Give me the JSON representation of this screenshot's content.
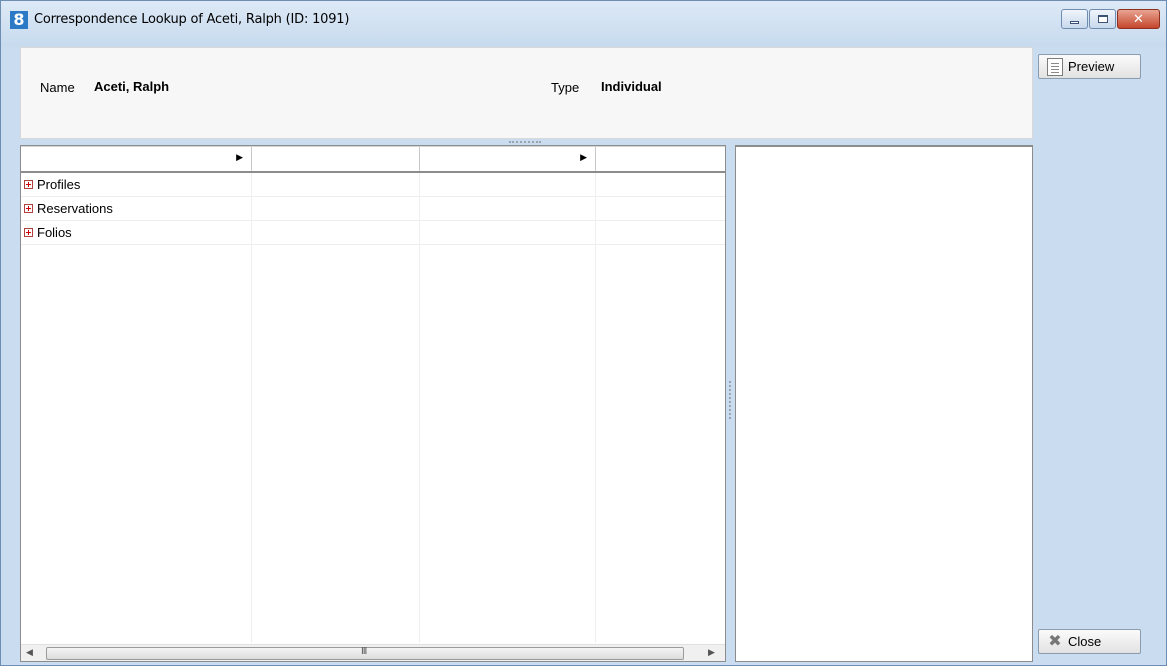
{
  "window": {
    "title": "Correspondence Lookup of Aceti, Ralph (ID: 1091)",
    "app_icon_glyph": "8",
    "controls": {
      "close_glyph": "✕"
    }
  },
  "header": {
    "name_label": "Name",
    "name_value": "Aceti, Ralph",
    "type_label": "Type",
    "type_value": "Individual"
  },
  "grid": {
    "rows": [
      {
        "label": "Profiles"
      },
      {
        "label": "Reservations"
      },
      {
        "label": "Folios"
      }
    ],
    "scroll_grip": "III"
  },
  "actions": {
    "preview_label": "Preview",
    "close_label": "Close"
  },
  "colors": {
    "window_frame": "#c9dcf0",
    "accent": "#2c79c6",
    "close_button": "#c4462b"
  }
}
